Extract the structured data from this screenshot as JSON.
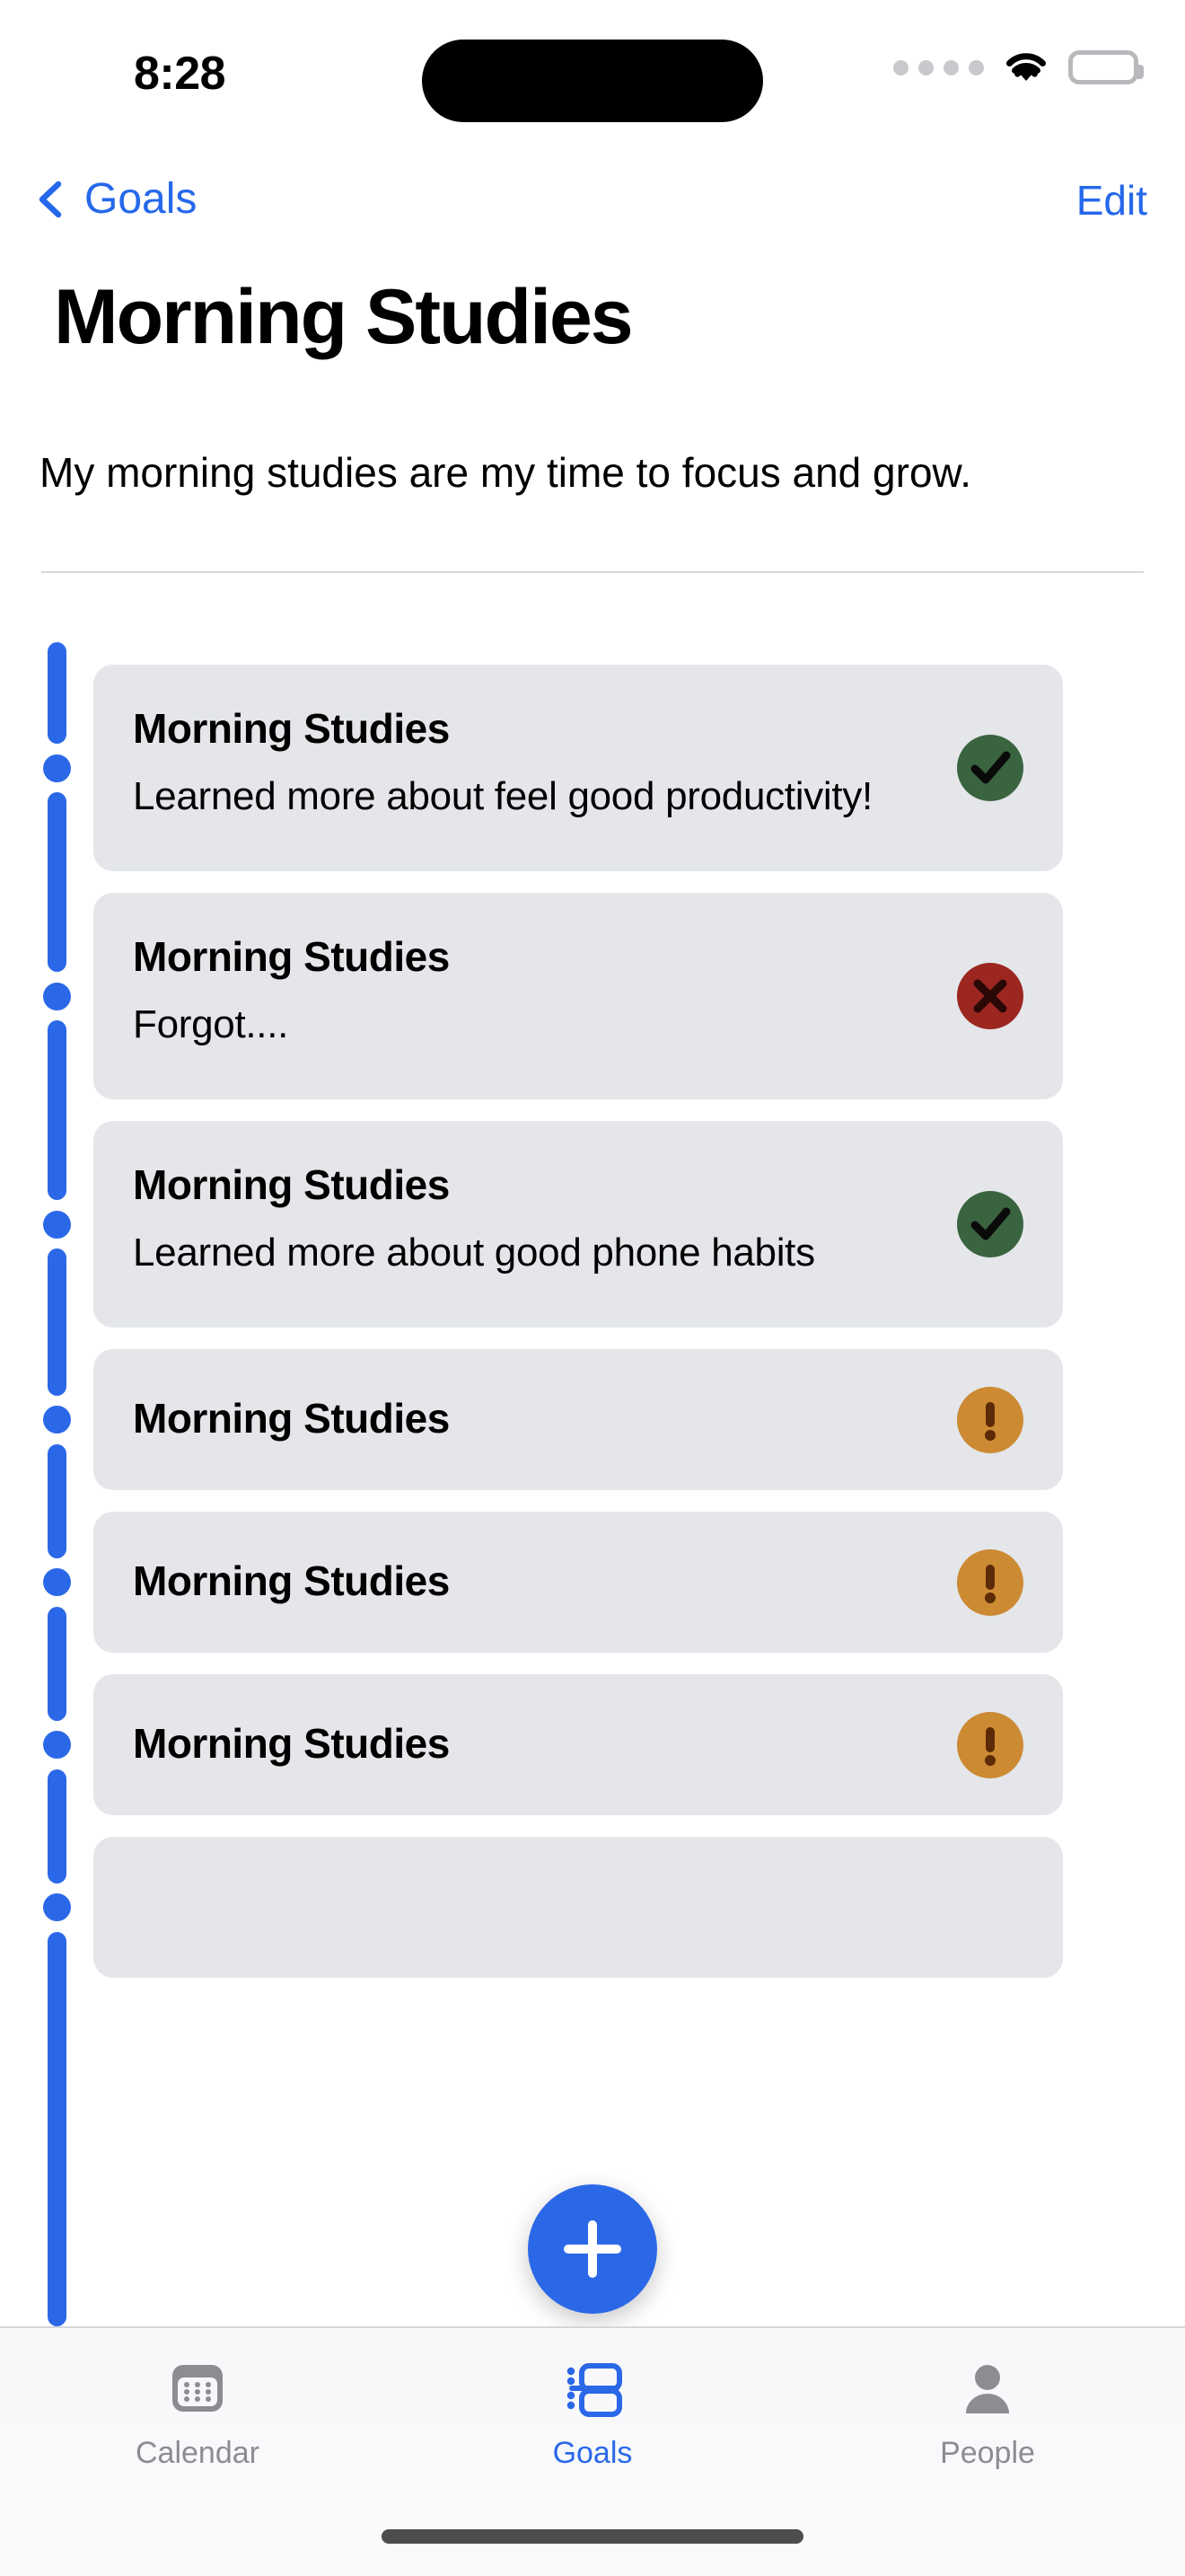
{
  "status_bar": {
    "time": "8:28",
    "signal_icon": "signal-dots-icon",
    "wifi_icon": "wifi-icon",
    "battery_icon": "battery-full-icon"
  },
  "nav": {
    "back_label": "Goals",
    "back_icon": "chevron-left-icon",
    "edit_label": "Edit"
  },
  "header": {
    "title": "Morning Studies",
    "subtitle": "My morning studies are my time to focus and grow."
  },
  "colors": {
    "accent_blue": "#2b68e8",
    "card_bg": "#e4e6ea",
    "success_green": "#3a6340",
    "fail_red": "#9c2620",
    "pending_orange": "#cc8a33",
    "inactive_gray": "#8c8c92"
  },
  "entries": [
    {
      "title": "Morning Studies",
      "description": "Learned more about feel good productivity!",
      "status": "complete",
      "status_icon": "check-circle-icon"
    },
    {
      "title": "Morning Studies",
      "description": "Forgot....",
      "status": "missed",
      "status_icon": "x-circle-icon"
    },
    {
      "title": "Morning Studies",
      "description": "Learned more about good phone habits",
      "status": "complete",
      "status_icon": "check-circle-icon"
    },
    {
      "title": "Morning Studies",
      "description": "",
      "status": "pending",
      "status_icon": "exclamation-circle-icon"
    },
    {
      "title": "Morning Studies",
      "description": "",
      "status": "pending",
      "status_icon": "exclamation-circle-icon"
    },
    {
      "title": "Morning Studies",
      "description": "",
      "status": "pending",
      "status_icon": "exclamation-circle-icon"
    },
    {
      "title": "",
      "description": "",
      "status": "pending",
      "status_icon": "exclamation-circle-icon"
    }
  ],
  "fab": {
    "icon": "plus-icon",
    "label": "Add"
  },
  "tabbar": {
    "items": [
      {
        "label": "Calendar",
        "icon": "calendar-icon",
        "active": false
      },
      {
        "label": "Goals",
        "icon": "goals-list-icon",
        "active": true
      },
      {
        "label": "People",
        "icon": "person-icon",
        "active": false
      }
    ]
  }
}
